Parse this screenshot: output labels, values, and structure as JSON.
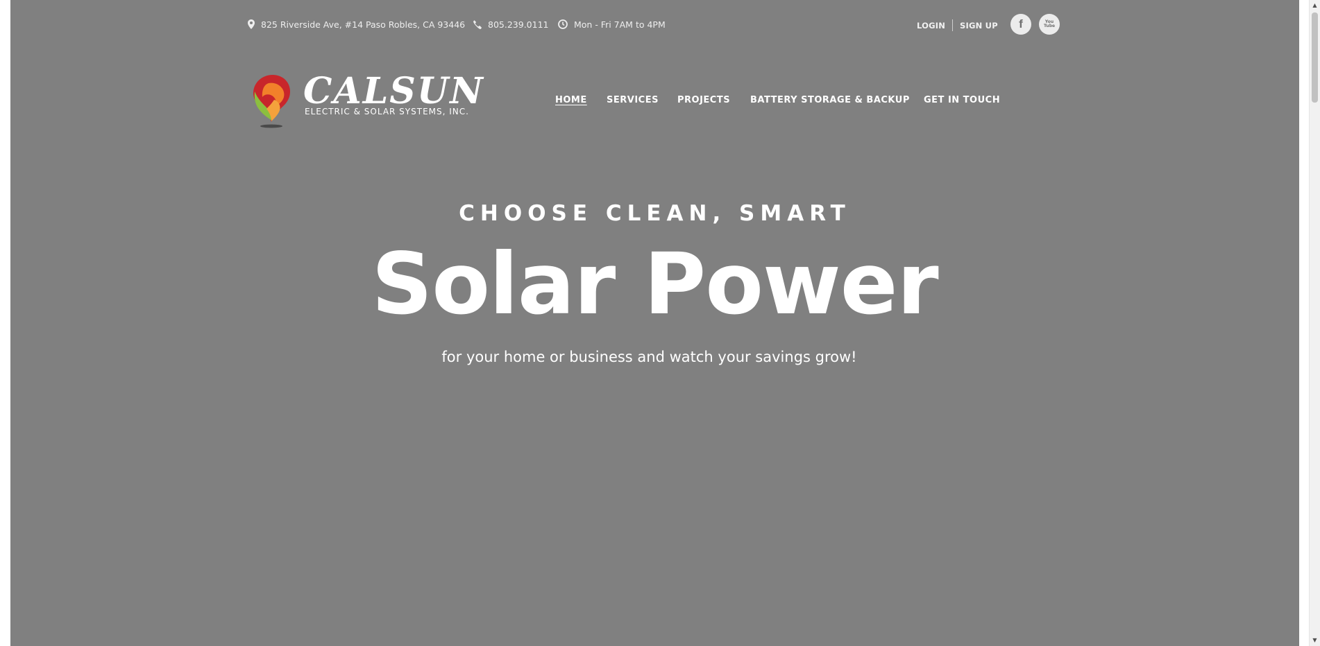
{
  "topbar": {
    "address": "825 Riverside Ave, #14 Paso Robles, CA 93446",
    "phone": "805.239.0111",
    "hours": "Mon - Fri 7AM to 4PM",
    "login_label": "LOGIN",
    "signup_label": "SIGN UP",
    "social": [
      {
        "name": "facebook-icon",
        "glyph": "f"
      },
      {
        "name": "youtube-icon",
        "glyph": "You Tube"
      }
    ]
  },
  "brand": {
    "name": "CALSUN",
    "tagline": "ELECTRIC & SOLAR SYSTEMS, INC.",
    "colors": {
      "red": "#c8262b",
      "orange": "#f2812a",
      "green": "#8cbf3f"
    }
  },
  "nav": {
    "items": [
      {
        "label": "HOME",
        "active": true
      },
      {
        "label": "SERVICES",
        "active": false
      },
      {
        "label": "PROJECTS",
        "active": false
      },
      {
        "label": "BATTERY STORAGE & BACKUP",
        "active": false
      },
      {
        "label": "GET IN TOUCH",
        "active": false
      }
    ]
  },
  "hero": {
    "kicker": "CHOOSE CLEAN, SMART",
    "title": "Solar Power",
    "subtitle": "for your home or business and watch your savings grow!"
  },
  "theme": {
    "overlay": "#808080",
    "text": "#ffffff"
  }
}
